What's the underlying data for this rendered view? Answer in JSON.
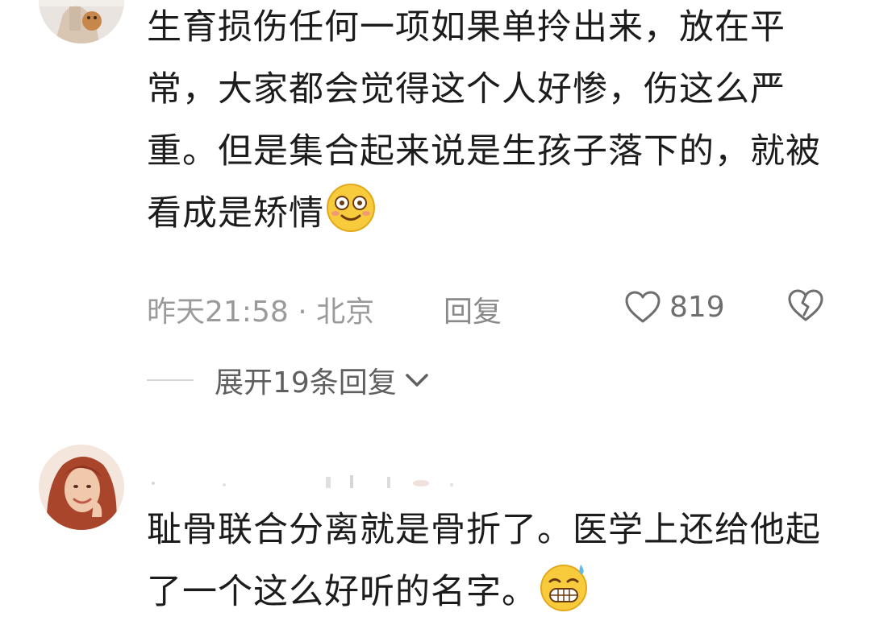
{
  "comments": [
    {
      "text": "生育损伤任何一项如果单拎出来，放在平常，大家都会觉得这个人好惨，伤这么严重。但是集合起来说是生孩子落下的，就被看成是矫情",
      "emoji": "dizzy-smile-emoji",
      "time_location": "昨天21:58 · 北京",
      "reply_label": "回复",
      "like_count": "819",
      "expand_label": "展开19条回复"
    },
    {
      "text": "耻骨联合分离就是骨折了。医学上还给他起了一个这么好听的名字。",
      "emoji": "grimace-sweat-emoji"
    }
  ],
  "colors": {
    "text": "#1c1c1c",
    "meta": "#9a9a9a",
    "expand": "#5f5f5f"
  }
}
